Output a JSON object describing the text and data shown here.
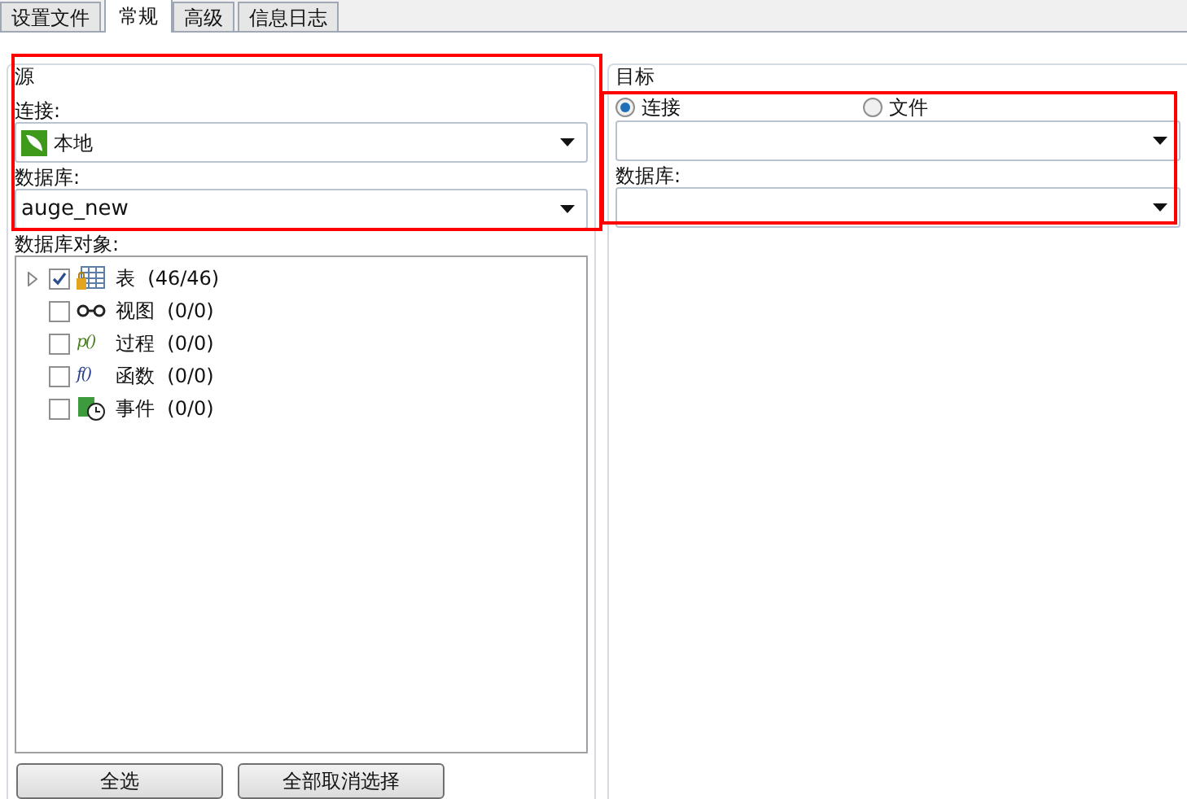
{
  "tabs": [
    {
      "label": "设置文件",
      "selected": false
    },
    {
      "label": "常规",
      "selected": true
    },
    {
      "label": "高级",
      "selected": false
    },
    {
      "label": "信息日志",
      "selected": false
    }
  ],
  "source": {
    "title": "源",
    "connection_label": "连接:",
    "connection_value": "本地",
    "database_label": "数据库:",
    "database_value": "auge_new",
    "objects_label": "数据库对象:",
    "objects": [
      {
        "kind": "table",
        "name": "表",
        "count": "(46/46)",
        "checked": true,
        "expandable": true
      },
      {
        "kind": "view",
        "name": "视图",
        "count": "(0/0)",
        "checked": false,
        "expandable": false
      },
      {
        "kind": "procedure",
        "glyph": "p()",
        "name": "过程",
        "count": "(0/0)",
        "checked": false,
        "expandable": false
      },
      {
        "kind": "function",
        "glyph": "f()",
        "name": "函数",
        "count": "(0/0)",
        "checked": false,
        "expandable": false
      },
      {
        "kind": "event",
        "name": "事件",
        "count": "(0/0)",
        "checked": false,
        "expandable": false
      }
    ],
    "buttons": [
      "全选",
      "全部取消选择"
    ]
  },
  "target": {
    "title": "目标",
    "options": [
      {
        "label": "连接",
        "selected": true
      },
      {
        "label": "文件",
        "selected": false
      }
    ],
    "database_label": "数据库:"
  }
}
